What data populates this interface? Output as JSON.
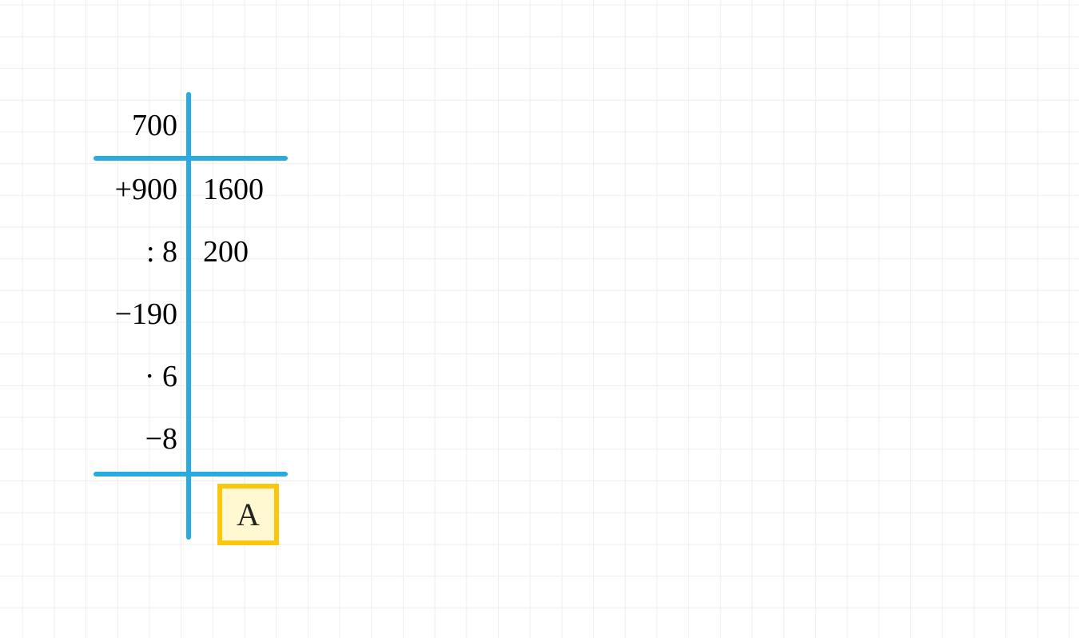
{
  "rows": {
    "start": "700",
    "op1": "+900",
    "res1": "1600",
    "op2": ": 8",
    "res2": "200",
    "op3": "−190",
    "res3": "",
    "op4": "· 6",
    "res4": "",
    "op5": "−8",
    "res5": ""
  },
  "answer_label": "A",
  "chart_data": {
    "type": "table",
    "description": "Sequential arithmetic chain (Rechenbaum). Start value then apply each operation, writing intermediate results on the right.",
    "start": 700,
    "steps": [
      {
        "operation": "+",
        "operand": 900,
        "result": 1600
      },
      {
        "operation": ":",
        "operand": 8,
        "result": 200
      },
      {
        "operation": "-",
        "operand": 190,
        "result": null
      },
      {
        "operation": "·",
        "operand": 6,
        "result": null
      },
      {
        "operation": "-",
        "operand": 8,
        "result": null
      }
    ],
    "final_label": "A"
  }
}
